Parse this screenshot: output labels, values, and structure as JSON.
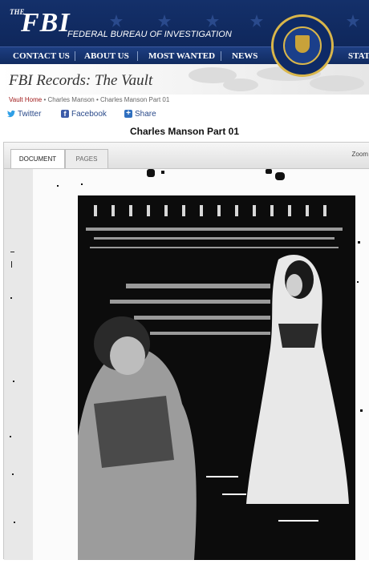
{
  "header": {
    "logo_the": "THE",
    "logo_fbi": "FBI",
    "logo_subtitle": "FEDERAL BUREAU OF INVESTIGATION",
    "seal_name": "fbi-seal"
  },
  "nav": {
    "items": [
      "CONTACT US",
      "ABOUT US",
      "MOST WANTED",
      "NEWS",
      "STAT"
    ]
  },
  "vault": {
    "title": "FBI Records: The Vault"
  },
  "breadcrumb": {
    "home": "Vault Home",
    "sep1": "•",
    "item1": "Charles Manson",
    "sep2": "•",
    "item2": "Charles Manson Part 01"
  },
  "social": {
    "twitter": "Twitter",
    "facebook": "Facebook",
    "share": "Share",
    "twitter_icon": "twitter-icon",
    "facebook_icon": "facebook-icon",
    "share_icon": "share-plus-icon"
  },
  "document": {
    "title": "Charles Manson Part 01"
  },
  "viewer": {
    "tab_document": "DOCUMENT",
    "tab_pages": "PAGES",
    "zoom_label": "Zoom"
  },
  "colors": {
    "header_blue": "#14306a",
    "nav_blue": "#1d3e82",
    "gold": "#d9b64a",
    "breadcrumb_red": "#a01b1b",
    "link_blue": "#2a4a8a"
  }
}
